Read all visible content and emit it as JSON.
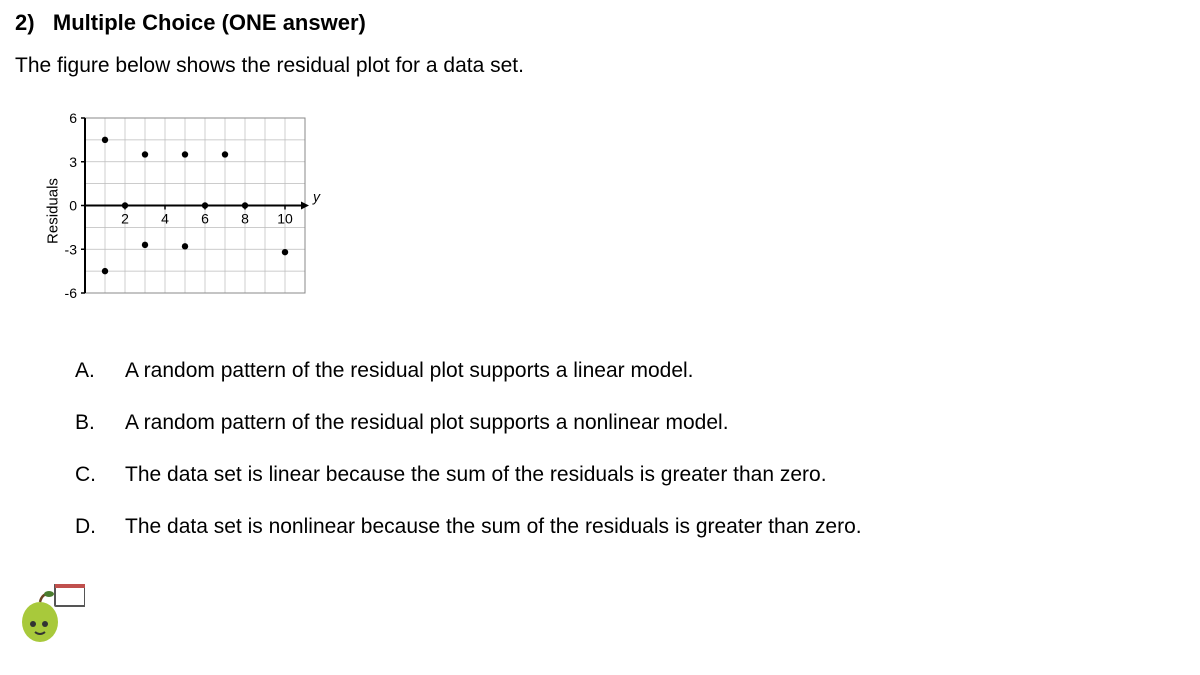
{
  "question": {
    "number_label": "2)",
    "type_label": "Multiple Choice (ONE answer)",
    "stem": "The figure below shows the residual plot for a data set."
  },
  "options": [
    {
      "letter": "A.",
      "text": "A random pattern of the residual plot supports a linear model."
    },
    {
      "letter": "B.",
      "text": "A random pattern of the residual plot supports a nonlinear model."
    },
    {
      "letter": "C.",
      "text": "The data set is linear because the sum of the residuals is greater than zero."
    },
    {
      "letter": "D.",
      "text": "The data set is nonlinear because the sum of the residuals is greater than zero."
    }
  ],
  "chart_data": {
    "type": "scatter",
    "title": "",
    "xlabel": "y",
    "ylabel": "Residuals",
    "xlim": [
      0,
      11
    ],
    "ylim": [
      -6,
      6
    ],
    "xticks": [
      2,
      4,
      6,
      8,
      10
    ],
    "yticks": [
      -6,
      -3,
      0,
      3,
      6
    ],
    "points": [
      {
        "x": 1,
        "y": 4.5
      },
      {
        "x": 1,
        "y": -4.5
      },
      {
        "x": 2,
        "y": 0
      },
      {
        "x": 3,
        "y": 3.5
      },
      {
        "x": 3,
        "y": -2.7
      },
      {
        "x": 5,
        "y": 3.5
      },
      {
        "x": 5,
        "y": -2.8
      },
      {
        "x": 6,
        "y": 0
      },
      {
        "x": 7,
        "y": 3.5
      },
      {
        "x": 8,
        "y": 0
      },
      {
        "x": 10,
        "y": -3.2
      }
    ]
  }
}
